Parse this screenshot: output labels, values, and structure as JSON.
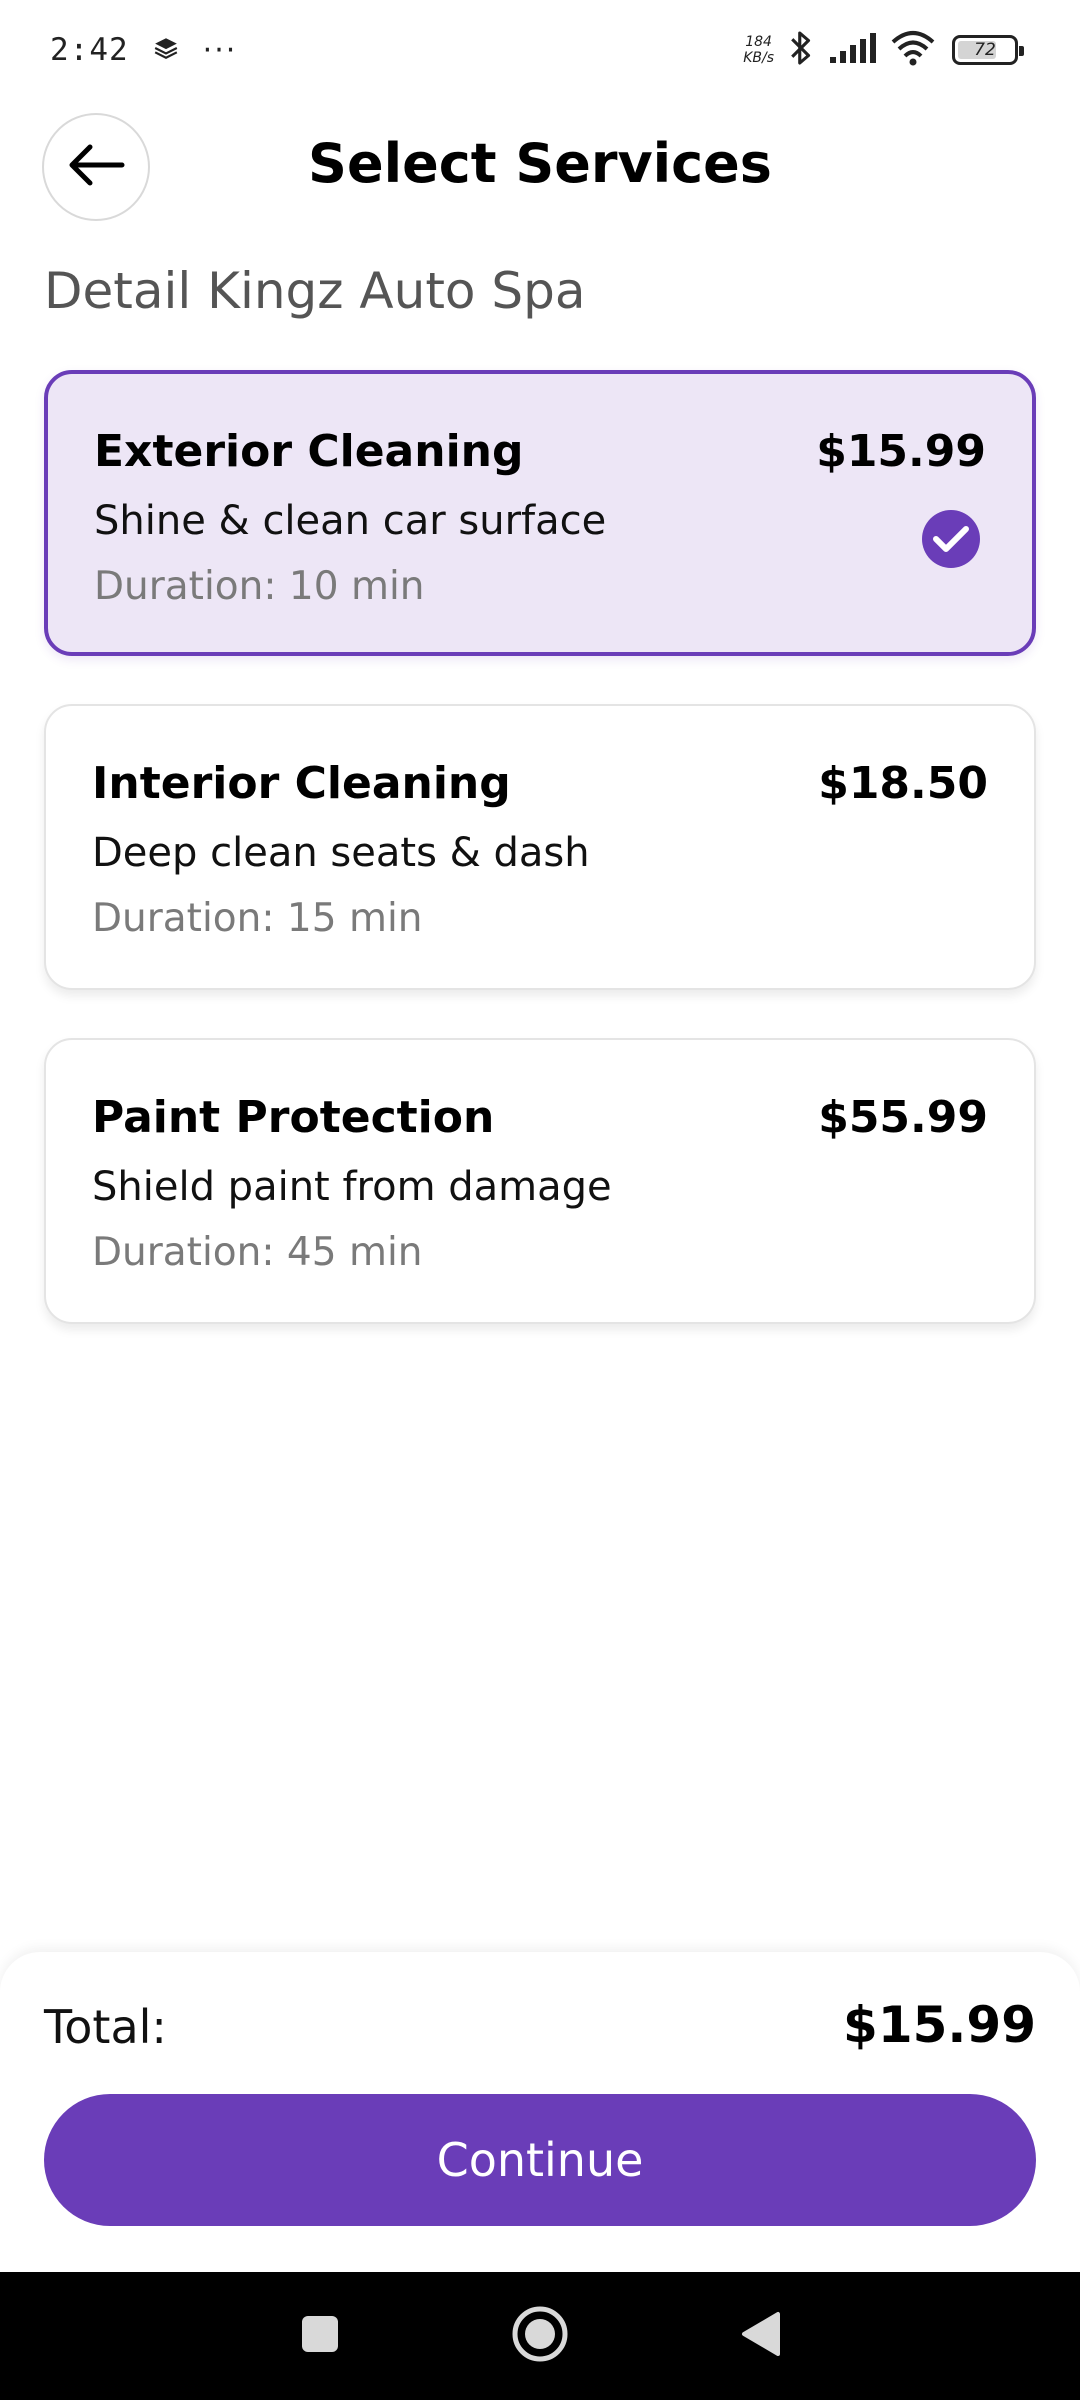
{
  "status_bar": {
    "time": "2:42",
    "more_dots": "···",
    "net_speed_value": "184",
    "net_speed_unit": "KB/s",
    "battery_level": "72"
  },
  "header": {
    "title": "Select Services",
    "back_icon": "arrow-left-icon"
  },
  "shop": {
    "name": "Detail Kingz Auto Spa"
  },
  "services": [
    {
      "title": "Exterior Cleaning",
      "price": "$15.99",
      "description": "Shine & clean car surface",
      "duration": "Duration: 10 min",
      "selected": true
    },
    {
      "title": "Interior Cleaning",
      "price": "$18.50",
      "description": "Deep clean seats & dash",
      "duration": "Duration: 15 min",
      "selected": false
    },
    {
      "title": "Paint Protection",
      "price": "$55.99",
      "description": "Shield paint from damage",
      "duration": "Duration: 45 min",
      "selected": false
    }
  ],
  "footer": {
    "total_label": "Total:",
    "total_value": "$15.99",
    "continue_label": "Continue"
  },
  "colors": {
    "accent": "#6a3db8",
    "selected_background": "#ede6f6",
    "muted_text": "#7a7a7a"
  },
  "nav_bar": {
    "recents_icon": "square-icon",
    "home_icon": "circle-home-icon",
    "back_icon": "triangle-back-icon"
  }
}
